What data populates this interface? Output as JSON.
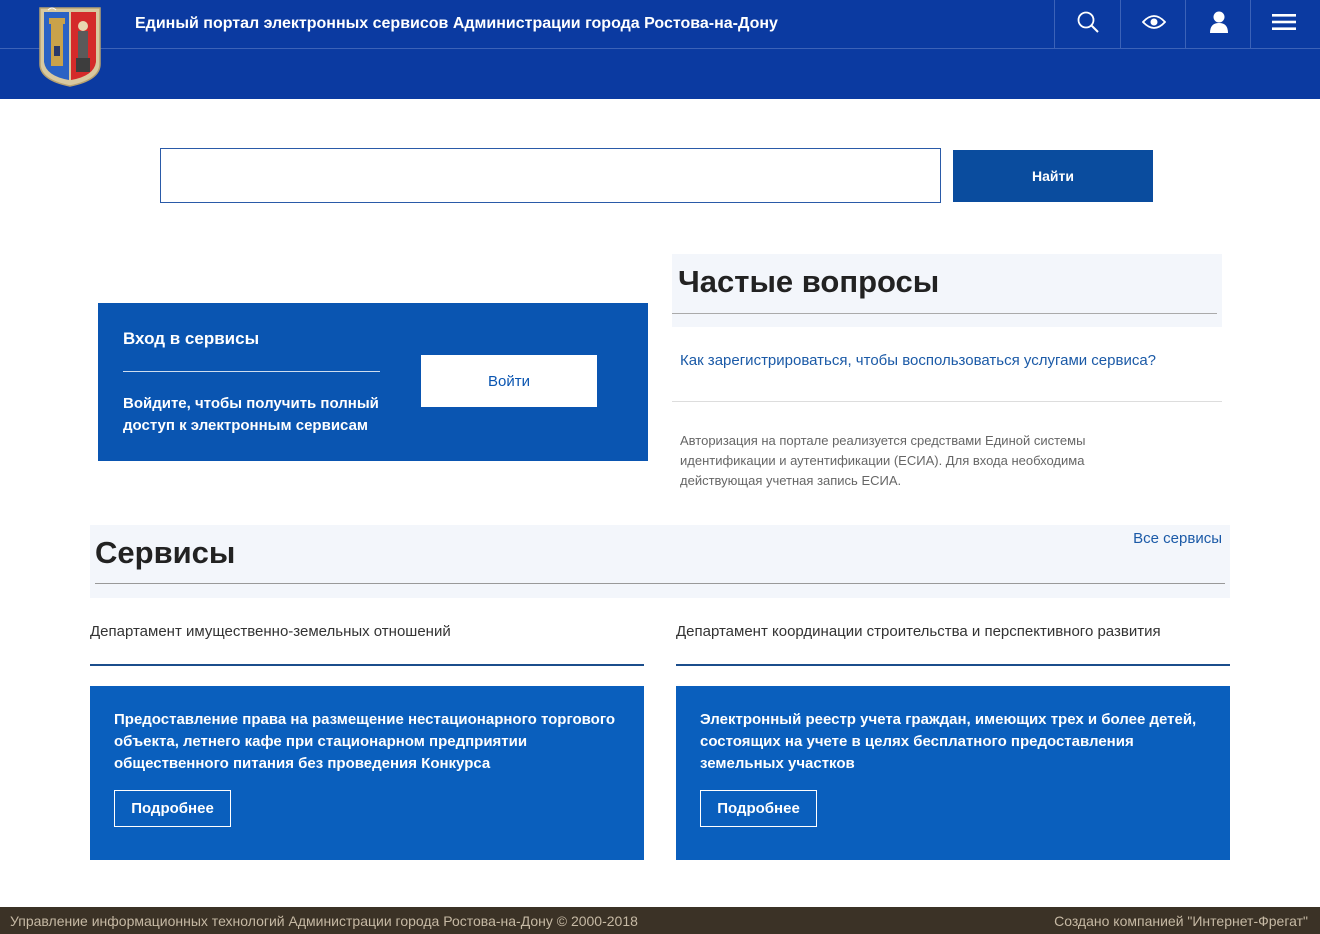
{
  "header": {
    "title": "Единый портал электронных сервисов Администрации города Ростова-на-Дону",
    "buttons": [
      {
        "icon": "search-icon"
      },
      {
        "icon": "eye-icon"
      },
      {
        "icon": "user-icon"
      },
      {
        "icon": "menu-icon"
      }
    ],
    "colors": {
      "background": "#0b3aa1"
    }
  },
  "search": {
    "value": "",
    "placeholder": "",
    "button_label": "Найти"
  },
  "login": {
    "title": "Вход в сервисы",
    "description": "Войдите, чтобы получить полный доступ к электронным сервисам",
    "button_label": "Войти"
  },
  "faq": {
    "title": "Частые вопросы",
    "question": "Как зарегистрироваться, чтобы воспользоваться услугами сервиса?",
    "answer": "Авторизация на портале реализуется средствами Единой системы идентификации и аутентификации (ЕСИА). Для входа необходима действующая учетная запись ЕСИА."
  },
  "services": {
    "title": "Сервисы",
    "all_link": "Все сервисы",
    "columns": [
      {
        "department": "Департамент имущественно-земельных отношений",
        "card_text": "Предоставление права на размещение нестационарного торгового объекта, летнего кафе при стационарном предприятии общественного питания без проведения Конкурса",
        "button_label": "Подробнее"
      },
      {
        "department": "Департамент координации строительства и перспективного развития",
        "card_text": "Электронный реестр учета граждан, имеющих трех и более детей, состоящих на учете в целях бесплатного предоставления земельных участков",
        "button_label": "Подробнее"
      }
    ]
  },
  "footer": {
    "left": "Управление информационных технологий Администрации города Ростова-на-Дону © 2000-2018",
    "right": "Создано компанией \"Интернет-Фрегат\""
  }
}
